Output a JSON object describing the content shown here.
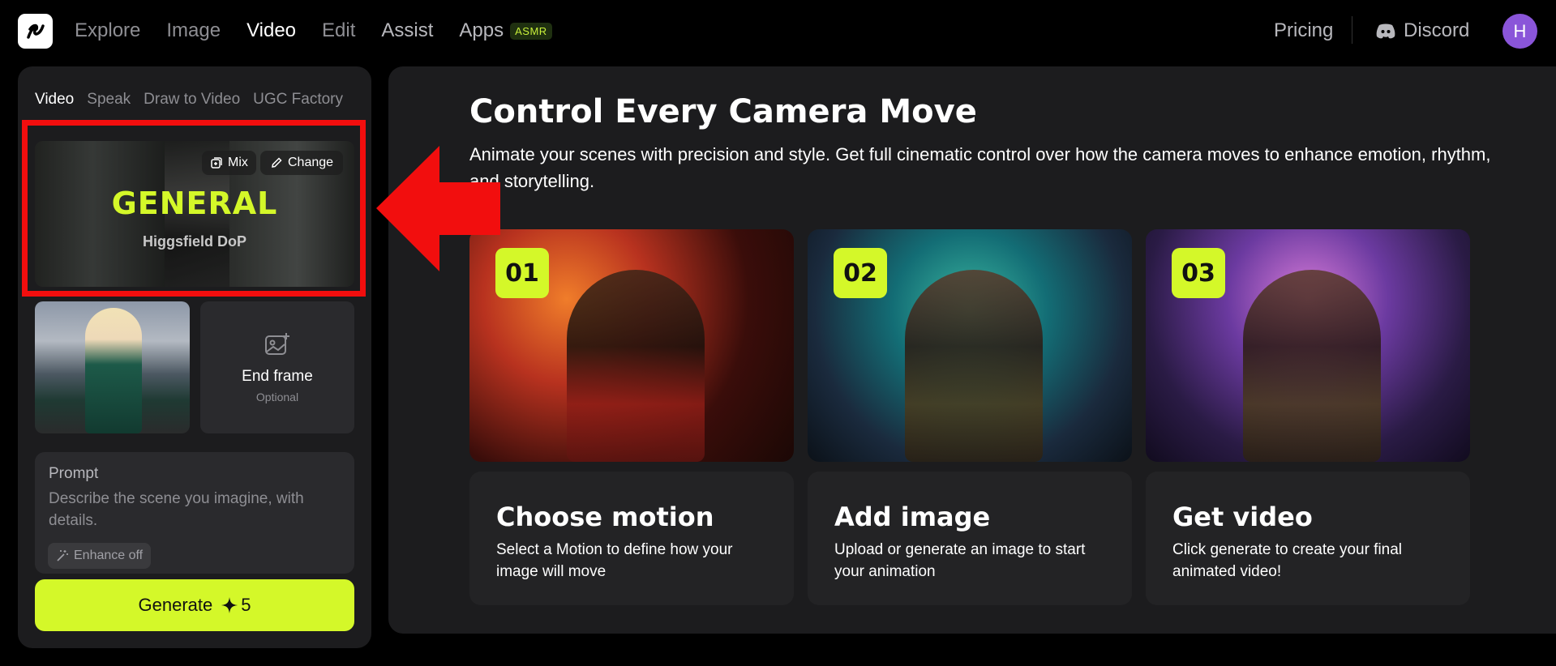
{
  "nav": {
    "items": [
      {
        "label": "Explore",
        "active": false
      },
      {
        "label": "Image",
        "active": false
      },
      {
        "label": "Video",
        "active": true
      },
      {
        "label": "Edit",
        "active": false
      },
      {
        "label": "Assist",
        "active": false
      },
      {
        "label": "Apps",
        "active": false
      }
    ],
    "apps_badge": "ASMR",
    "pricing": "Pricing",
    "discord": "Discord",
    "avatar_initial": "H"
  },
  "left_panel": {
    "tabs": [
      "Video",
      "Speak",
      "Draw to Video",
      "UGC Factory"
    ],
    "active_tab": "Video",
    "motion": {
      "title": "GENERAL",
      "subtitle": "Higgsfield DoP",
      "mix_label": "Mix",
      "change_label": "Change"
    },
    "end_frame": {
      "title": "End frame",
      "subtitle": "Optional"
    },
    "prompt": {
      "label": "Prompt",
      "placeholder": "Describe the scene you imagine, with details.",
      "enhance_label": "Enhance off"
    },
    "generate": {
      "label": "Generate",
      "cost": "5"
    }
  },
  "main": {
    "title": "Control Every Camera Move",
    "description": "Animate your scenes with precision and style. Get full cinematic control over how the camera moves to enhance emotion, rhythm, and storytelling.",
    "steps": [
      {
        "number": "01",
        "title": "Choose motion",
        "desc": "Select a Motion to define how your image will move"
      },
      {
        "number": "02",
        "title": "Add image",
        "desc": "Upload or generate an image to start your animation"
      },
      {
        "number": "03",
        "title": "Get video",
        "desc": "Click generate to create your final animated video!"
      }
    ]
  },
  "colors": {
    "accent": "#d4f829",
    "highlight": "#f20e0e",
    "panel": "#1c1c1e",
    "avatar": "#8a55d9"
  }
}
